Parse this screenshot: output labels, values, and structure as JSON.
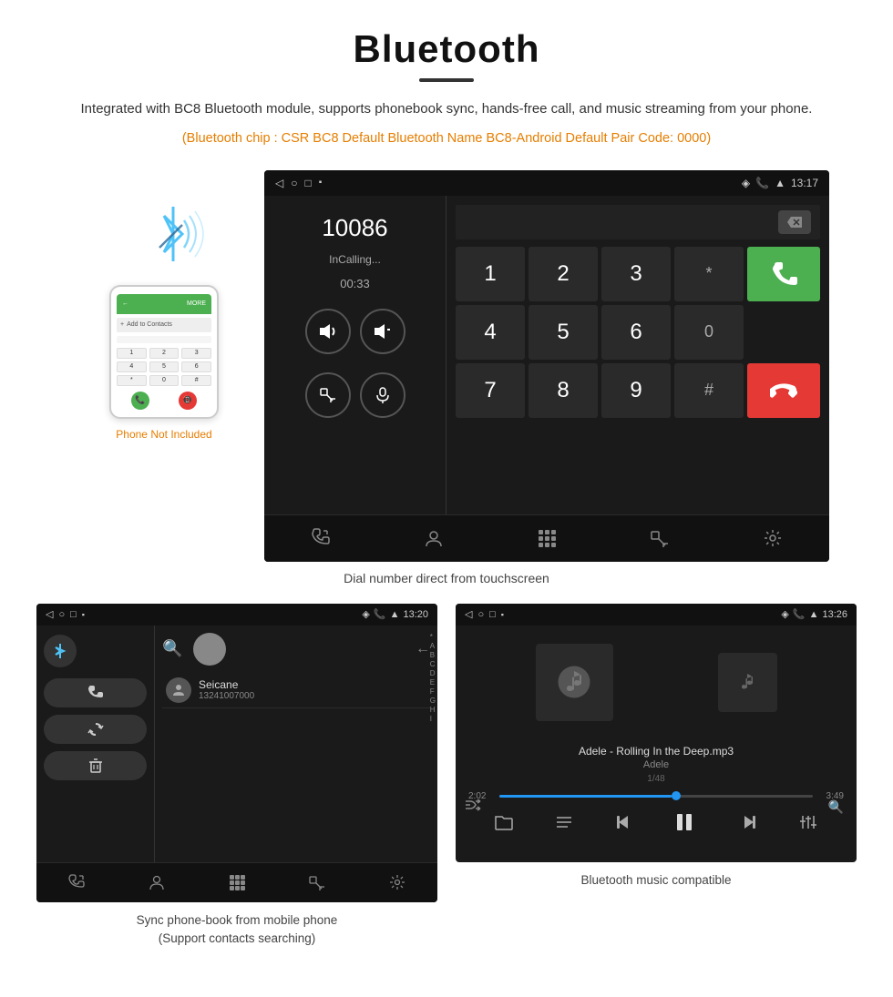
{
  "page": {
    "title": "Bluetooth",
    "subtitle": "Integrated with BC8 Bluetooth module, supports phonebook sync, hands-free call, and music streaming from your phone.",
    "orange_info": "(Bluetooth chip : CSR BC8    Default Bluetooth Name BC8-Android    Default Pair Code: 0000)",
    "title_underline": true
  },
  "dial_screen": {
    "status_time": "13:17",
    "number": "10086",
    "call_status": "InCalling...",
    "call_timer": "00:33",
    "keypad": [
      "1",
      "2",
      "3",
      "*",
      "4",
      "5",
      "6",
      "0",
      "7",
      "8",
      "9",
      "#"
    ],
    "caption": "Dial number direct from touchscreen"
  },
  "phone_side": {
    "not_included_label": "Phone Not Included"
  },
  "contacts_screen": {
    "status_time": "13:20",
    "contact_name": "Seicane",
    "contact_number": "13241007000",
    "alphabet": [
      "*",
      "A",
      "B",
      "C",
      "D",
      "E",
      "F",
      "G",
      "H",
      "I"
    ],
    "caption_line1": "Sync phone-book from mobile phone",
    "caption_line2": "(Support contacts searching)"
  },
  "music_screen": {
    "status_time": "13:26",
    "track_name": "Adele - Rolling In the Deep.mp3",
    "artist": "Adele",
    "track_position": "1/48",
    "time_current": "2:02",
    "time_total": "3:49",
    "progress_percent": 55,
    "caption": "Bluetooth music compatible"
  },
  "nav_icons": {
    "back": "◁",
    "home": "○",
    "recent": "□",
    "phone_call": "☎",
    "contacts": "👤",
    "keypad": "⊞",
    "transfer": "⇄",
    "settings": "⚙"
  }
}
